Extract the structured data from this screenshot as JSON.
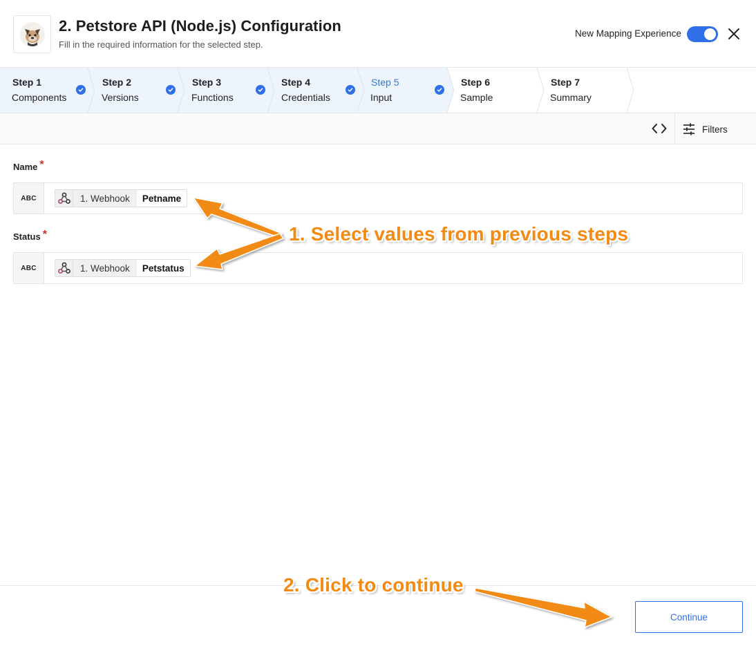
{
  "header": {
    "title": "2. Petstore API (Node.js) Configuration",
    "subtitle": "Fill in the required information for the selected step.",
    "toggle_label": "New Mapping Experience",
    "toggle_on": true,
    "logo_icon": "dog-avatar-icon",
    "close_icon": "close-icon"
  },
  "steps": [
    {
      "num": "Step 1",
      "name": "Components",
      "done": true
    },
    {
      "num": "Step 2",
      "name": "Versions",
      "done": true
    },
    {
      "num": "Step 3",
      "name": "Functions",
      "done": true
    },
    {
      "num": "Step 4",
      "name": "Credentials",
      "done": true
    },
    {
      "num": "Step 5",
      "name": "Input",
      "done": true,
      "active": true
    },
    {
      "num": "Step 6",
      "name": "Sample",
      "done": false
    },
    {
      "num": "Step 7",
      "name": "Summary",
      "done": false
    }
  ],
  "toolbar": {
    "code_icon": "code-brackets-icon",
    "filters_label": "Filters",
    "filters_icon": "sliders-icon"
  },
  "fields": [
    {
      "label": "Name",
      "required": true,
      "type": "ABC",
      "source": "1. Webhook",
      "source_icon": "webhook-icon",
      "value": "Petname"
    },
    {
      "label": "Status",
      "required": true,
      "type": "ABC",
      "source": "1. Webhook",
      "source_icon": "webhook-icon",
      "value": "Petstatus"
    }
  ],
  "annotations": {
    "select_values": "1. Select values from previous steps",
    "click_continue": "2. Click to continue"
  },
  "footer": {
    "continue_label": "Continue"
  },
  "colors": {
    "accent": "#2f6fe8",
    "annotation": "#f28a14",
    "required": "#d0312d",
    "active_step_bg": "#eef4fc"
  }
}
